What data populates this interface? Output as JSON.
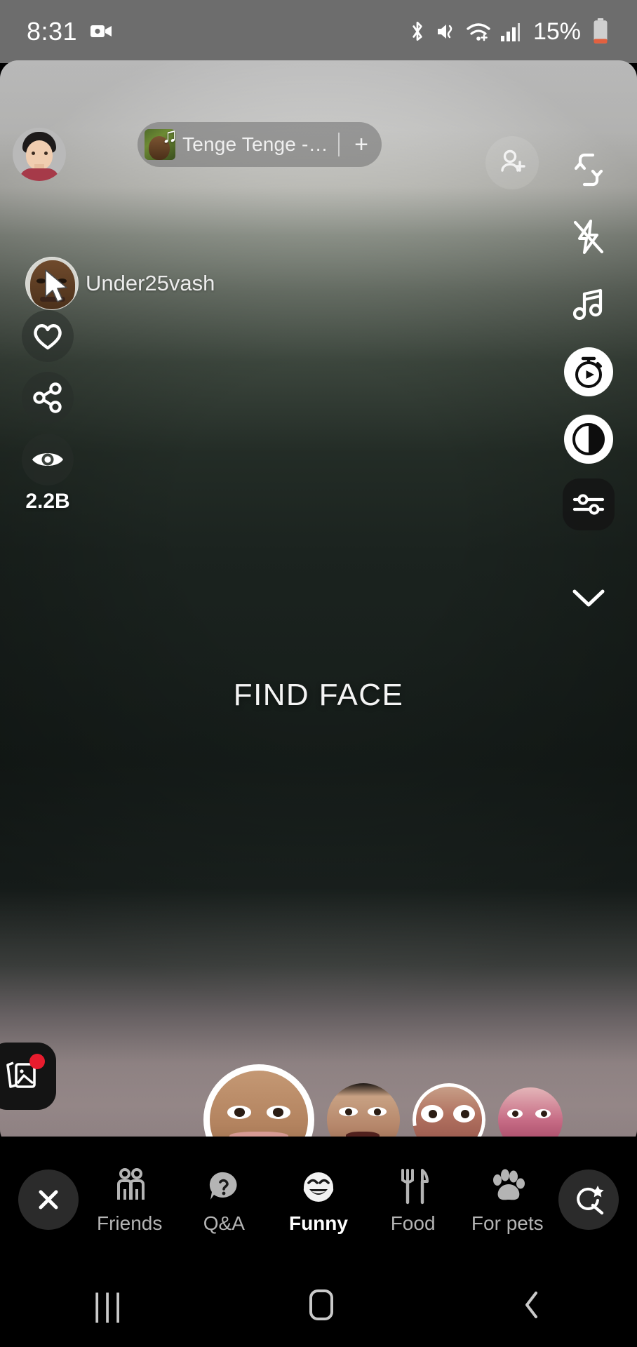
{
  "status_bar": {
    "time": "8:31",
    "battery_percent": "15%",
    "icons": [
      "screen-recorder-icon",
      "bluetooth-icon",
      "sound-vibrate-off-icon",
      "wifi-plus-icon",
      "cellular-signal-icon",
      "battery-icon"
    ]
  },
  "music": {
    "title": "Tenge Tenge - F.B.B.",
    "add_label": "+",
    "thumb_icon": "music-note-icon"
  },
  "top_actions": {
    "add_person_icon": "add-person-icon"
  },
  "right_rail": [
    {
      "name": "flip-camera",
      "icon": "flip-camera-icon",
      "style": "plain"
    },
    {
      "name": "flash-off",
      "icon": "flash-off-icon",
      "style": "plain"
    },
    {
      "name": "music",
      "icon": "music-note-icon",
      "style": "plain"
    },
    {
      "name": "timer",
      "icon": "timer-icon",
      "style": "round-light"
    },
    {
      "name": "beauty-contrast",
      "icon": "contrast-circle-icon",
      "style": "round-light"
    },
    {
      "name": "adjust-settings",
      "icon": "sliders-icon",
      "style": "dark-rounded"
    },
    {
      "name": "collapse",
      "icon": "chevron-down-icon",
      "style": "plain"
    }
  ],
  "left_rail": {
    "profile_avatar": "avatar",
    "creator_name": "Under25vash",
    "creator_avatar": "creator-avatar",
    "like_icon": "heart-icon",
    "share_icon": "share-icon",
    "views_icon": "eye-icon",
    "views_count": "2.2B"
  },
  "viewport": {
    "hint_text": "FIND FACE"
  },
  "gallery_button": {
    "icon": "gallery-icon",
    "has_badge": true,
    "badge_color": "#e81c2e"
  },
  "effects_carousel": [
    {
      "name": "effect-selected",
      "selected": true,
      "loading": false
    },
    {
      "name": "effect-2",
      "selected": false,
      "loading": false
    },
    {
      "name": "effect-3",
      "selected": false,
      "loading": true
    },
    {
      "name": "effect-4",
      "selected": false,
      "loading": false
    }
  ],
  "category_bar": {
    "close_icon": "close-icon",
    "search_icon": "search-star-icon",
    "categories": [
      {
        "label": "Friends",
        "icon": "friends-icon",
        "active": false
      },
      {
        "label": "Q&A",
        "icon": "question-bubble-icon",
        "active": false
      },
      {
        "label": "Funny",
        "icon": "laughing-emoji-icon",
        "active": true
      },
      {
        "label": "Food",
        "icon": "fork-knife-icon",
        "active": false
      },
      {
        "label": "For pets",
        "icon": "paw-icon",
        "active": false
      }
    ]
  },
  "nav_bar": {
    "recents": "|||",
    "home_icon": "home-icon",
    "back": "‹"
  },
  "colors": {
    "accent_badge": "#e81c2e",
    "active_text": "#ffffff",
    "inactive_text": "#b4b4b4",
    "status_bar_bg": "#6d6d6d"
  }
}
